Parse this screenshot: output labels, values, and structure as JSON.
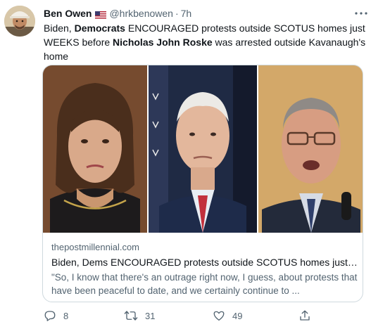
{
  "tweet": {
    "author_name": "Ben Owen",
    "author_flag": "us-flag-icon",
    "handle": "@hrkbenowen",
    "separator": "·",
    "time": "7h",
    "text": {
      "p1": "Biden, ",
      "b1": "Democrats",
      "p2": " ENCOURAGED protests outside SCOTUS homes just WEEKS before ",
      "b2": "Nicholas John Roske",
      "p3": " was arrested outside Kavanaugh's home"
    }
  },
  "card": {
    "domain": "thepostmillennial.com",
    "title": "Biden, Dems ENCOURAGED protests outside SCOTUS homes just W...",
    "description": "\"So, I know that there's an outrage right now, I guess, about protests that have been peaceful to date, and we certainly continue to ..."
  },
  "actions": {
    "replies": "8",
    "retweets": "31",
    "likes": "49"
  },
  "colors": {
    "text": "#0f1419",
    "secondary": "#536471",
    "border": "#cfd9de"
  }
}
